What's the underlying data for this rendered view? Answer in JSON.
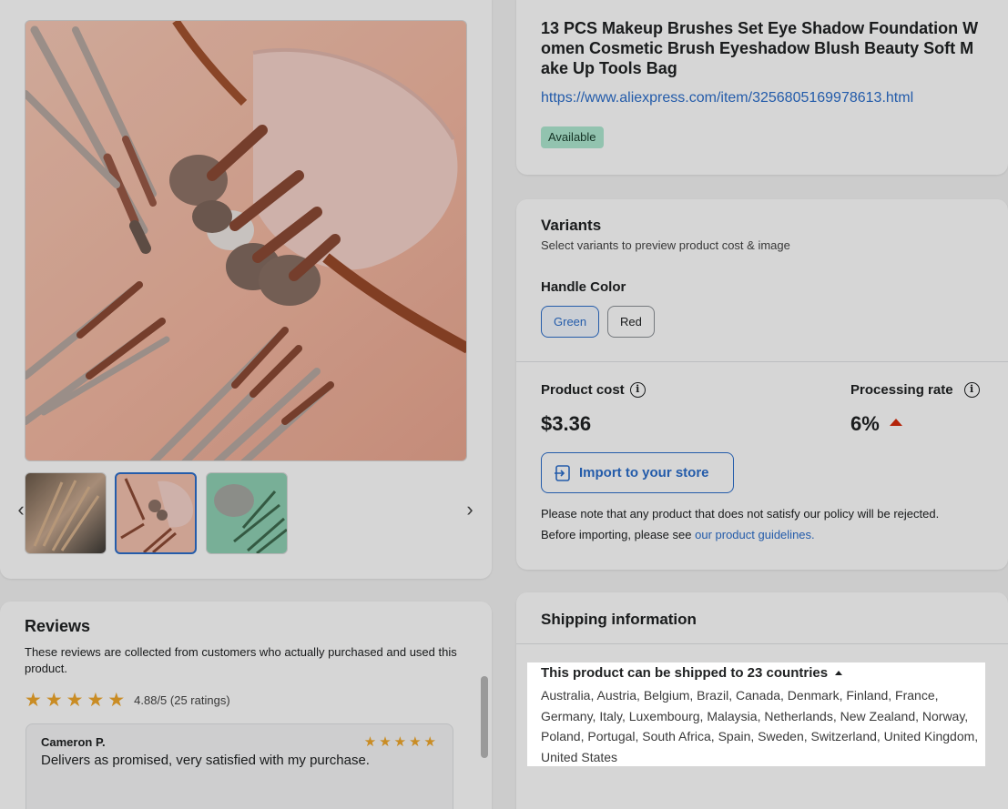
{
  "product": {
    "title": "13 PCS Makeup Brushes Set Eye Shadow Foundation Women Cosmetic Brush Eyeshadow Blush Beauty Soft Make Up Tools Bag",
    "url": "https://www.aliexpress.com/item/3256805169978613.html",
    "status_badge": "Available"
  },
  "gallery": {
    "thumbnails": [
      "thumbnail-1",
      "thumbnail-2",
      "thumbnail-3"
    ],
    "selected_index": 1,
    "prev_icon": "chevron-left-icon",
    "next_icon": "chevron-right-icon"
  },
  "variants": {
    "title": "Variants",
    "subtitle": "Select variants to preview product cost & image",
    "option_name": "Handle Color",
    "options": [
      "Green",
      "Red"
    ],
    "selected": "Green"
  },
  "pricing": {
    "product_cost_label": "Product cost",
    "product_cost_value": "$3.36",
    "processing_rate_label": "Processing rate",
    "processing_rate_value": "6%",
    "trend_color": "#d72c0d"
  },
  "import": {
    "button_label": "Import to your store",
    "note_line1": "Please note that any product that does not satisfy our policy will be rejected.",
    "note_line2_prefix": "Before importing, please see ",
    "note_link": "our product guidelines."
  },
  "reviews": {
    "title": "Reviews",
    "description": "These reviews are collected from customers who actually purchased and used this product.",
    "rating_text": "4.88/5 (25 ratings)",
    "stars": 5,
    "items": [
      {
        "reviewer": "Cameron P.",
        "stars": 5,
        "text": "Delivers as promised, very satisfied with my purchase."
      }
    ]
  },
  "shipping": {
    "title": "Shipping information",
    "heading": "This product can be shipped to 23 countries",
    "countries": "Australia, Austria, Belgium, Brazil, Canada, Denmark, Finland, France, Germany, Italy, Luxembourg, Malaysia, Netherlands, New Zealand, Norway, Poland, Portugal, South Africa, Spain, Sweden, Switzerland, United Kingdom, United States"
  },
  "colors": {
    "accent": "#2c6ecb",
    "star": "#f0a72c",
    "badge_bg": "#aee9d1"
  }
}
